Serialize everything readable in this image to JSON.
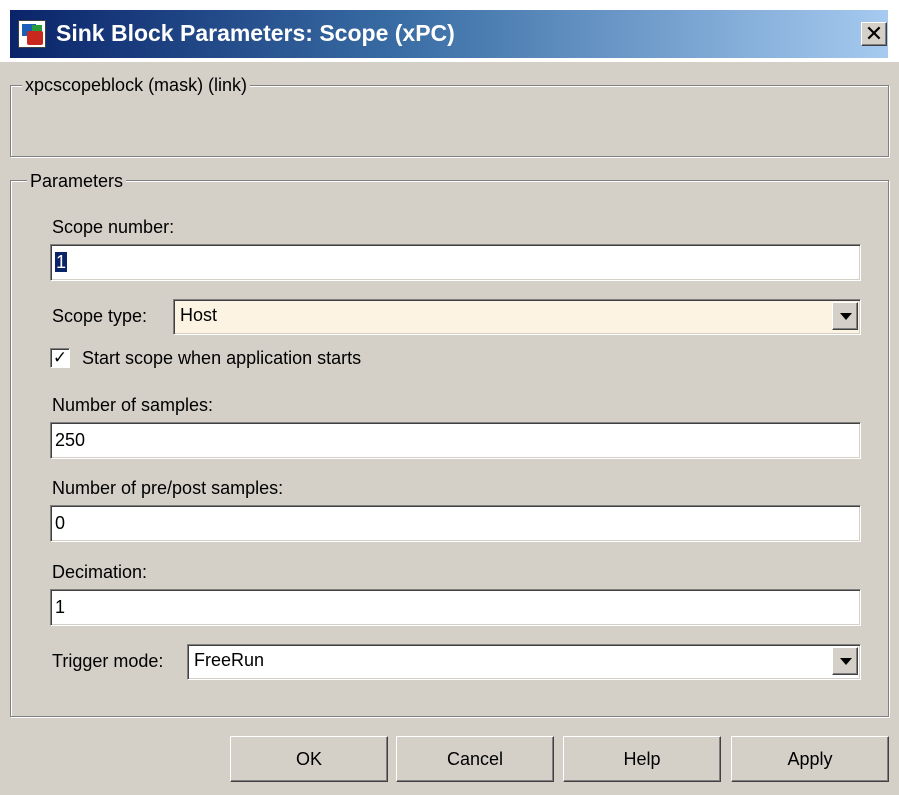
{
  "window": {
    "title": "Sink Block Parameters: Scope (xPC)",
    "close_glyph": "✕"
  },
  "mask_group": {
    "legend": "xpcscopeblock (mask) (link)"
  },
  "parameters": {
    "legend": "Parameters",
    "scope_number": {
      "label": "Scope number:",
      "value": "1"
    },
    "scope_type": {
      "label": "Scope type:",
      "value": "Host"
    },
    "start_scope": {
      "label": "Start scope when application starts",
      "checked": true,
      "check_glyph": "✓"
    },
    "number_of_samples": {
      "label": "Number of samples:",
      "value": "250"
    },
    "pre_post_samples": {
      "label": "Number of pre/post samples:",
      "value": "0"
    },
    "decimation": {
      "label": "Decimation:",
      "value": "1"
    },
    "trigger_mode": {
      "label": "Trigger mode:",
      "value": "FreeRun"
    }
  },
  "buttons": {
    "ok": "OK",
    "cancel": "Cancel",
    "help": "Help",
    "apply": "Apply"
  },
  "colors": {
    "dialog_face": "#d4d0c8",
    "titlebar_start": "#0a246a",
    "titlebar_end": "#a6caf0",
    "selection": "#0a246a",
    "highlighted_combo": "#fdf3e3"
  },
  "icons": {
    "window_icon": "simulink-block-icon",
    "close": "close-icon",
    "dropdown": "chevron-down-icon",
    "checkmark": "checkmark-icon"
  }
}
